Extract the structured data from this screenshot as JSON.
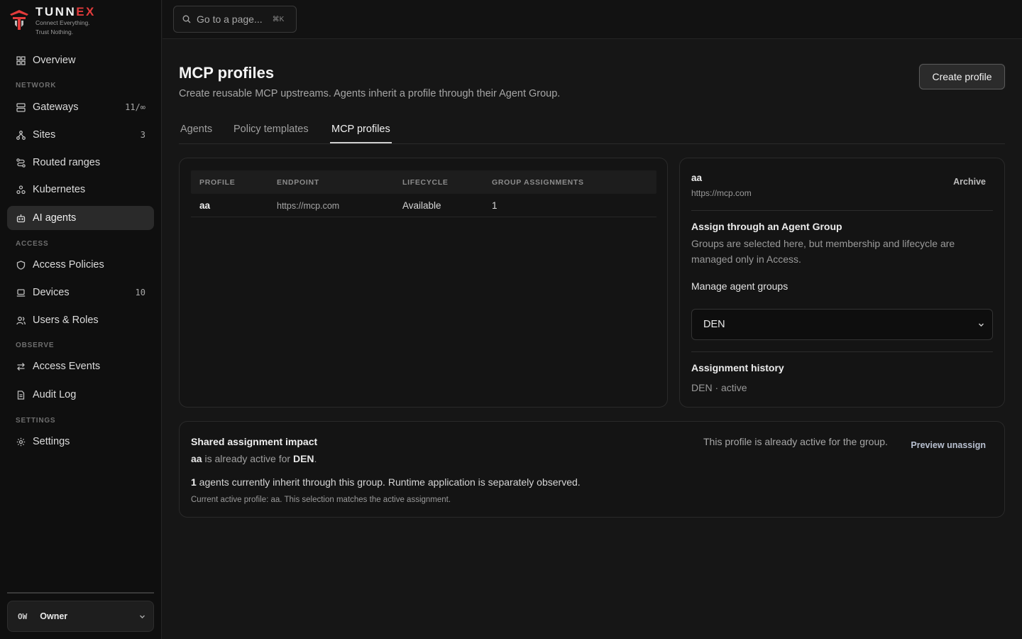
{
  "brand": {
    "name_part1": "TUNN",
    "name_part2": "EX",
    "tagline_line1": "Connect Everything.",
    "tagline_line2": "Trust Nothing.",
    "accent_color": "#e23b3b"
  },
  "search": {
    "label": "Go to a page...",
    "shortcut": "⌘K"
  },
  "sidebar": {
    "overview": "Overview",
    "sections": {
      "network": "NETWORK",
      "access": "ACCESS",
      "observe": "OBSERVE",
      "settings": "SETTINGS"
    },
    "items": {
      "gateways": {
        "label": "Gateways",
        "count": "11/∞"
      },
      "sites": {
        "label": "Sites",
        "count": "3"
      },
      "routed_ranges": {
        "label": "Routed ranges"
      },
      "kubernetes": {
        "label": "Kubernetes"
      },
      "ai_agents": {
        "label": "AI agents"
      },
      "access_policies": {
        "label": "Access Policies"
      },
      "devices": {
        "label": "Devices",
        "count": "10"
      },
      "users_roles": {
        "label": "Users & Roles"
      },
      "access_events": {
        "label": "Access Events"
      },
      "audit_log": {
        "label": "Audit Log"
      },
      "settings": {
        "label": "Settings"
      }
    },
    "user": {
      "initials": "OW",
      "name": "Owner"
    }
  },
  "page": {
    "title": "MCP profiles",
    "subtitle": "Create reusable MCP upstreams. Agents inherit a profile through their Agent Group.",
    "create_button": "Create profile",
    "tabs": [
      "Agents",
      "Policy templates",
      "MCP profiles"
    ]
  },
  "table": {
    "headers": [
      "PROFILE",
      "ENDPOINT",
      "LIFECYCLE",
      "GROUP ASSIGNMENTS"
    ],
    "rows": [
      {
        "profile": "aa",
        "endpoint": "https://mcp.com",
        "lifecycle": "Available",
        "assignments": "1"
      }
    ]
  },
  "detail": {
    "name": "aa",
    "url": "https://mcp.com",
    "archive": "Archive",
    "assign_heading": "Assign through an Agent Group",
    "assign_desc": "Groups are selected here, but membership and lifecycle are managed only in Access.",
    "manage_label": "Manage agent groups",
    "selected_group": "DEN",
    "history_heading": "Assignment history",
    "history_entry": "DEN · active"
  },
  "impact": {
    "heading": "Shared assignment impact",
    "profile": "aa",
    "active_text": " is already active for ",
    "group": "DEN",
    "period": ".",
    "agent_count": "1",
    "inherit_text": " agents currently inherit through this group. Runtime application is separately observed.",
    "current_note": "Current active profile: aa. This selection matches the active assignment.",
    "status": "This profile is already active for the group.",
    "preview": "Preview unassign"
  }
}
